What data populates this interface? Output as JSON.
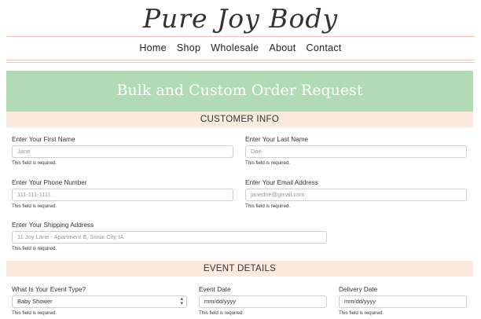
{
  "brand": {
    "logo_text": "Pure Joy Body"
  },
  "nav": {
    "items": [
      "Home",
      "Shop",
      "Wholesale",
      "About",
      "Contact"
    ]
  },
  "banner": {
    "title": "Bulk and Custom Order Request"
  },
  "customer_info": {
    "heading": "CUSTOMER INFO",
    "first_name": {
      "label": "Enter Your First Name",
      "placeholder": "Jane",
      "hint": "This field is required."
    },
    "last_name": {
      "label": "Enter Your Last Name",
      "placeholder": "Doe",
      "hint": "This field is required."
    },
    "phone": {
      "label": "Enter Your Phone Number",
      "placeholder": "111-111-1111",
      "hint": "This field is required."
    },
    "email": {
      "label": "Enter Your Email Address",
      "placeholder": "janedoe@gmail.com",
      "hint": "This field is required."
    },
    "address": {
      "label": "Enter Your Shipping Address",
      "placeholder": "11 Joy Lane - Apartment B, Sioux City IA",
      "hint": "This field is required."
    }
  },
  "event_details": {
    "heading": "EVENT DETAILS",
    "event_type": {
      "label": "What Is Your Event Type?",
      "value": "Baby Shower",
      "hint": "This field is required."
    },
    "event_date": {
      "label": "Event Date",
      "placeholder": "mm/dd/yyyy",
      "hint": "This field is required."
    },
    "delivery_date": {
      "label": "Delivery Date",
      "placeholder": "mm/dd/yyyy",
      "hint": "This field is required."
    }
  }
}
